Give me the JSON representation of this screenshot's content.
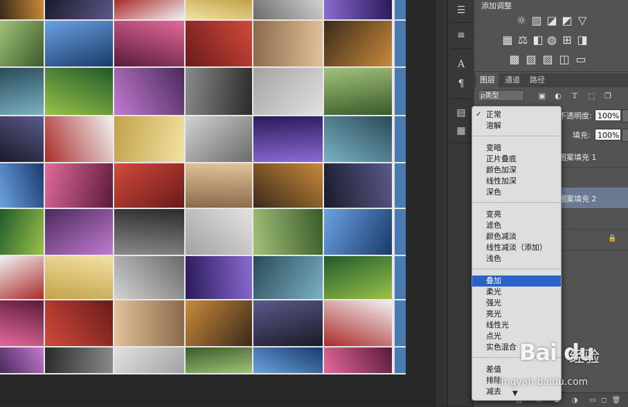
{
  "adjustments": {
    "title": "添加调整",
    "icons": [
      "brightness-contrast-icon",
      "levels-icon",
      "curves-icon",
      "exposure-icon",
      "vibrance-icon",
      "hue-saturation-icon",
      "color-balance-icon",
      "black-white-icon",
      "photo-filter-icon",
      "channel-mixer-icon",
      "color-lookup-icon",
      "invert-icon",
      "posterize-icon",
      "threshold-icon",
      "selective-color-icon",
      "gradient-map-icon"
    ]
  },
  "layers_panel": {
    "tabs": [
      "图层",
      "通道",
      "路径"
    ],
    "filter_label": "ρ类型",
    "opacity_label": "不透明度:",
    "opacity_value": "100%",
    "fill_label": "填充:",
    "fill_value": "100%",
    "layers": [
      {
        "name": "图案填充 1",
        "selected": false
      },
      {
        "name": "",
        "selected": false
      },
      {
        "name": "图案填充 2",
        "selected": true
      },
      {
        "name": "",
        "selected": false
      },
      {
        "name": "",
        "selected": false,
        "locked": true
      }
    ]
  },
  "blend_menu": {
    "groups": [
      [
        "正常",
        "溶解"
      ],
      [
        "变暗",
        "正片叠底",
        "颜色加深",
        "线性加深",
        "深色"
      ],
      [
        "变亮",
        "滤色",
        "颜色减淡",
        "线性减淡（添加）",
        "浅色"
      ],
      [
        "叠加",
        "柔光",
        "强光",
        "亮光",
        "线性光",
        "点光",
        "实色混合"
      ],
      [
        "差值",
        "排除",
        "减去"
      ]
    ],
    "checked": "正常",
    "highlighted": "叠加"
  },
  "watermark": {
    "logo": "Bai du",
    "text": "经验",
    "url": "jingyan.baidu.com"
  },
  "colors": {
    "panel_bg": "#535353",
    "highlight": "#2a62c8",
    "selected_layer": "#6b7a92"
  }
}
